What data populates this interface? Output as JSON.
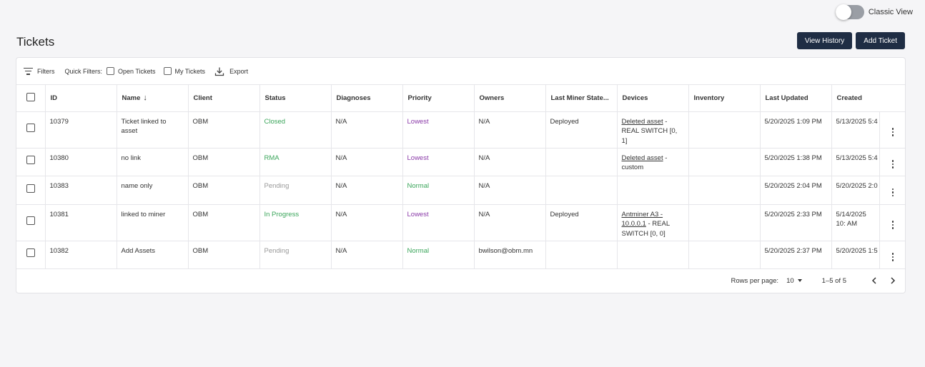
{
  "toggle": {
    "label": "Classic View"
  },
  "header": {
    "title": "Tickets",
    "view_history": "View History",
    "add_ticket": "Add Ticket"
  },
  "toolbar": {
    "filters": "Filters",
    "quick_filters": "Quick Filters:",
    "open_tickets": "Open Tickets",
    "my_tickets": "My Tickets",
    "export": "Export"
  },
  "columns": {
    "id": "ID",
    "name": "Name",
    "client": "Client",
    "status": "Status",
    "diagnoses": "Diagnoses",
    "priority": "Priority",
    "owners": "Owners",
    "last_miner_state": "Last Miner State...",
    "devices": "Devices",
    "inventory": "Inventory",
    "last_updated": "Last Updated",
    "created": "Created"
  },
  "rows": [
    {
      "id": "10379",
      "name": "Ticket linked to asset",
      "client": "OBM",
      "status": "Closed",
      "diagnoses": "N/A",
      "priority": "Lowest",
      "owners": "N/A",
      "last_miner_state": "Deployed",
      "device_link": "Deleted asset",
      "device_rest": " - REAL SWITCH [0, 1]",
      "inventory": "",
      "last_updated": "5/20/2025 1:09 PM",
      "created": "5/13/2025 5:4"
    },
    {
      "id": "10380",
      "name": "no link",
      "client": "OBM",
      "status": "RMA",
      "diagnoses": "N/A",
      "priority": "Lowest",
      "owners": "N/A",
      "last_miner_state": "",
      "device_link": "Deleted asset",
      "device_rest": " - custom",
      "inventory": "",
      "last_updated": "5/20/2025 1:38 PM",
      "created": "5/13/2025 5:4"
    },
    {
      "id": "10383",
      "name": "name only",
      "client": "OBM",
      "status": "Pending",
      "diagnoses": "N/A",
      "priority": "Normal",
      "owners": "N/A",
      "last_miner_state": "",
      "device_link": "",
      "device_rest": "",
      "inventory": "",
      "last_updated": "5/20/2025 2:04 PM",
      "created": "5/20/2025 2:0"
    },
    {
      "id": "10381",
      "name": "linked to miner",
      "client": "OBM",
      "status": "In Progress",
      "diagnoses": "N/A",
      "priority": "Lowest",
      "owners": "N/A",
      "last_miner_state": "Deployed",
      "device_link": "Antminer A3 - 10.0.0.1",
      "device_rest": " - REAL SWITCH [0, 0]",
      "inventory": "",
      "last_updated": "5/20/2025 2:33 PM",
      "created": "5/14/2025 10: AM"
    },
    {
      "id": "10382",
      "name": "Add Assets",
      "client": "OBM",
      "status": "Pending",
      "diagnoses": "N/A",
      "priority": "Normal",
      "owners": "bwilson@obm.mn",
      "last_miner_state": "",
      "device_link": "",
      "device_rest": "",
      "inventory": "",
      "last_updated": "5/20/2025 2:37 PM",
      "created": "5/20/2025 1:5"
    }
  ],
  "pagination": {
    "rows_per_page_label": "Rows per page:",
    "rows_per_page": "10",
    "range": "1–5 of 5"
  },
  "colors": {
    "primary": "#1f2d44",
    "status_green": "#3aa55a",
    "priority_lowest": "#8a3aa8",
    "pending_grey": "#999999"
  }
}
